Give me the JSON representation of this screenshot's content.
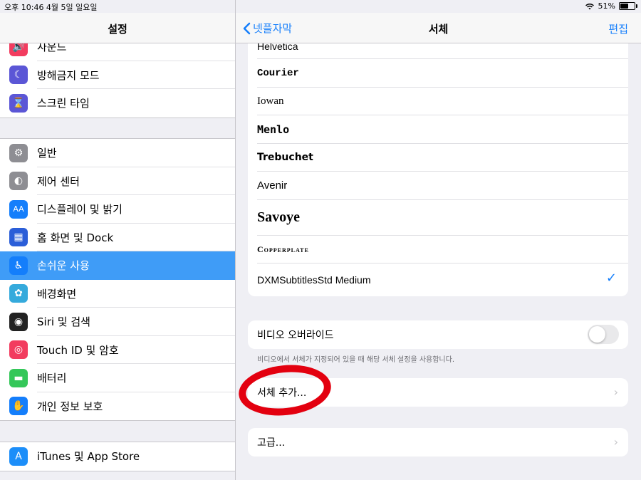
{
  "status_bar": {
    "time_date": "오후 10:46   4월 5일 일요일",
    "battery": "51%"
  },
  "left": {
    "title": "설정",
    "group1": [
      {
        "label": "사운드",
        "icon": "speaker-icon",
        "color": "#f23c5f"
      },
      {
        "label": "방해금지 모드",
        "icon": "moon-icon",
        "color": "#5b56d6"
      },
      {
        "label": "스크린 타임",
        "icon": "hourglass-icon",
        "color": "#5b56d6"
      }
    ],
    "group2": [
      {
        "label": "일반",
        "icon": "gear-icon",
        "color": "#8e8e93"
      },
      {
        "label": "제어 센터",
        "icon": "toggles-icon",
        "color": "#8e8e93"
      },
      {
        "label": "디스플레이 및 밝기",
        "icon": "text-size-icon",
        "color": "#147efb"
      },
      {
        "label": "홈 화면 및 Dock",
        "icon": "home-grid-icon",
        "color": "#2b5ed8"
      },
      {
        "label": "손쉬운 사용",
        "icon": "accessibility-icon",
        "color": "#147efb"
      },
      {
        "label": "배경화면",
        "icon": "flower-icon",
        "color": "#35aadc"
      },
      {
        "label": "Siri 및 검색",
        "icon": "siri-icon",
        "color": "#222222"
      },
      {
        "label": "Touch ID 및 암호",
        "icon": "fingerprint-icon",
        "color": "#f23c5f"
      },
      {
        "label": "배터리",
        "icon": "battery-icon",
        "color": "#34c759"
      },
      {
        "label": "개인 정보 보호",
        "icon": "hand-icon",
        "color": "#147efb"
      }
    ],
    "group3": [
      {
        "label": "iTunes 및 App Store",
        "icon": "app-store-icon",
        "color": "#1c8ef9"
      }
    ]
  },
  "right": {
    "back_label": "넷플자막",
    "title": "서체",
    "edit_label": "편집",
    "fonts": [
      {
        "name": "Helvetica",
        "family": "Liberation Sans",
        "weight": "normal",
        "size": "14px"
      },
      {
        "name": "Courier",
        "family": "Liberation Mono",
        "weight": "bold",
        "size": "14px"
      },
      {
        "name": "Iowan",
        "family": "Liberation Serif",
        "weight": "normal",
        "size": "15px"
      },
      {
        "name": "Menlo",
        "family": "DejaVu Sans Mono",
        "weight": "bold",
        "size": "15px"
      },
      {
        "name": "Trebuchet",
        "family": "DejaVu Sans",
        "weight": "bold",
        "size": "14px"
      },
      {
        "name": "Avenir",
        "family": "Liberation Sans",
        "weight": "normal",
        "size": "15px"
      },
      {
        "name": "Savoye",
        "family": "Liberation Serif",
        "weight": "bold",
        "size": "20px"
      },
      {
        "name": "Copperplate",
        "family": "Liberation Serif",
        "weight": "bold",
        "size": "12px"
      },
      {
        "name": "DXMSubtitlesStd Medium",
        "family": "Liberation Sans",
        "weight": "normal",
        "size": "14px",
        "selected": true
      }
    ],
    "video_override_label": "비디오 오버라이드",
    "video_override_on": false,
    "video_override_note": "비디오에서 서체가 지정되어 있을 때 해당 서체 설정을 사용합니다.",
    "add_font_label": "서체 추가...",
    "advanced_label": "고급..."
  }
}
